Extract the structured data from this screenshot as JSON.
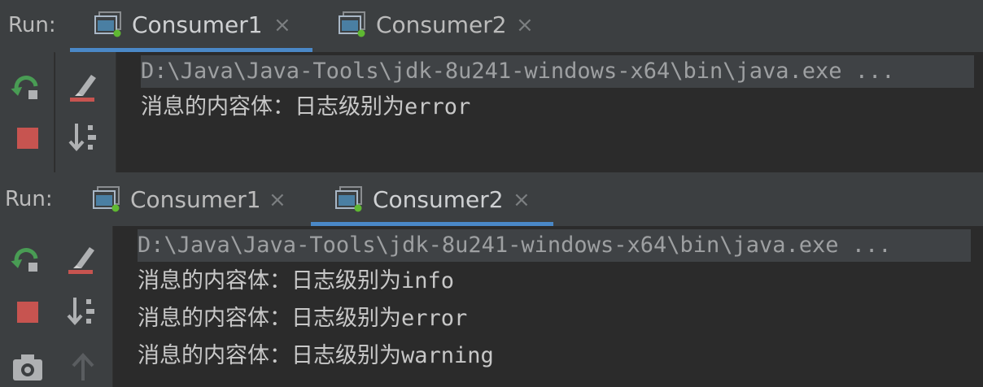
{
  "panels": [
    {
      "run_label": "Run:",
      "tabs": [
        {
          "label": "Consumer1",
          "close": "×",
          "active": true,
          "icon": "console-run-icon"
        },
        {
          "label": "Consumer2",
          "close": "×",
          "active": false,
          "icon": "console-run-icon"
        }
      ],
      "toolbar": [
        "rerun-icon",
        "stop-icon",
        "clear-icon",
        "scroll-to-end-icon"
      ],
      "output": [
        "D:\\Java\\Java-Tools\\jdk-8u241-windows-x64\\bin\\java.exe ...",
        "消息的内容体：日志级别为error"
      ]
    },
    {
      "run_label": "Run:",
      "tabs": [
        {
          "label": "Consumer1",
          "close": "×",
          "active": false,
          "icon": "console-run-icon"
        },
        {
          "label": "Consumer2",
          "close": "×",
          "active": true,
          "icon": "console-run-icon"
        }
      ],
      "toolbar": [
        "rerun-icon",
        "stop-icon",
        "screenshot-icon",
        "clear-icon",
        "scroll-to-end-icon",
        "up-arrow-icon"
      ],
      "output": [
        "D:\\Java\\Java-Tools\\jdk-8u241-windows-x64\\bin\\java.exe ...",
        "消息的内容体：日志级别为info",
        "消息的内容体：日志级别为error",
        "消息的内容体：日志级别为warning"
      ]
    }
  ],
  "colors": {
    "accent": "#4a88c7",
    "rerun_green": "#499c54",
    "stop_red": "#c75450",
    "running_dot": "#5fb832"
  }
}
